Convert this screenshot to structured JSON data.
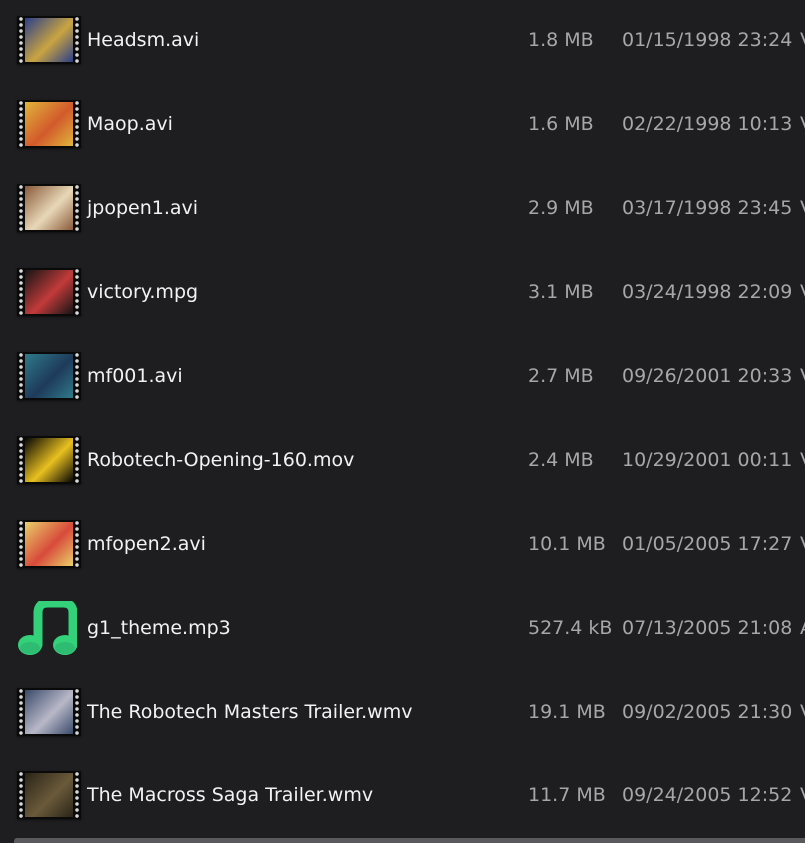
{
  "files": [
    {
      "name": "Headsm.avi",
      "size": "1.8 MB",
      "modified": "01/15/1998 23:24",
      "type": "V",
      "icon": "video-thumbnail-icon",
      "colors": [
        "#2a3f8a",
        "#c9a441"
      ]
    },
    {
      "name": "Maop.avi",
      "size": "1.6 MB",
      "modified": "02/22/1998 10:13",
      "type": "V",
      "icon": "video-thumbnail-icon",
      "colors": [
        "#e0b53a",
        "#d25a2c"
      ]
    },
    {
      "name": "jpopen1.avi",
      "size": "2.9 MB",
      "modified": "03/17/1998 23:45",
      "type": "V",
      "icon": "video-thumbnail-icon",
      "colors": [
        "#8a5a3a",
        "#e8d8b8"
      ]
    },
    {
      "name": "victory.mpg",
      "size": "3.1 MB",
      "modified": "03/24/1998 22:09",
      "type": "V",
      "icon": "video-thumbnail-icon",
      "colors": [
        "#141414",
        "#c23a3a"
      ]
    },
    {
      "name": "mf001.avi",
      "size": "2.7 MB",
      "modified": "09/26/2001 20:33",
      "type": "V",
      "icon": "video-thumbnail-icon",
      "colors": [
        "#2f7a8a",
        "#1e3a5a"
      ]
    },
    {
      "name": "Robotech-Opening-160.mov",
      "size": "2.4 MB",
      "modified": "10/29/2001 00:11",
      "type": "V",
      "icon": "video-thumbnail-icon",
      "colors": [
        "#050505",
        "#e8c020"
      ]
    },
    {
      "name": "mfopen2.avi",
      "size": "10.1 MB",
      "modified": "01/05/2005 17:27",
      "type": "V",
      "icon": "video-thumbnail-icon",
      "colors": [
        "#e8d06a",
        "#d84a3a"
      ]
    },
    {
      "name": "g1_theme.mp3",
      "size": "527.4 kB",
      "modified": "07/13/2005 21:08",
      "type": "A",
      "icon": "music-note-icon",
      "colors": [
        "#33d17a",
        "#26a269"
      ]
    },
    {
      "name": "The Robotech Masters Trailer.wmv",
      "size": "19.1 MB",
      "modified": "09/02/2005 21:30",
      "type": "V",
      "icon": "video-thumbnail-icon",
      "colors": [
        "#3a4a6a",
        "#b8b8c8"
      ]
    },
    {
      "name": "The Macross Saga Trailer.wmv",
      "size": "11.7 MB",
      "modified": "09/24/2005 12:52",
      "type": "V",
      "icon": "video-thumbnail-icon",
      "colors": [
        "#2a2418",
        "#6a5a3a"
      ]
    }
  ]
}
